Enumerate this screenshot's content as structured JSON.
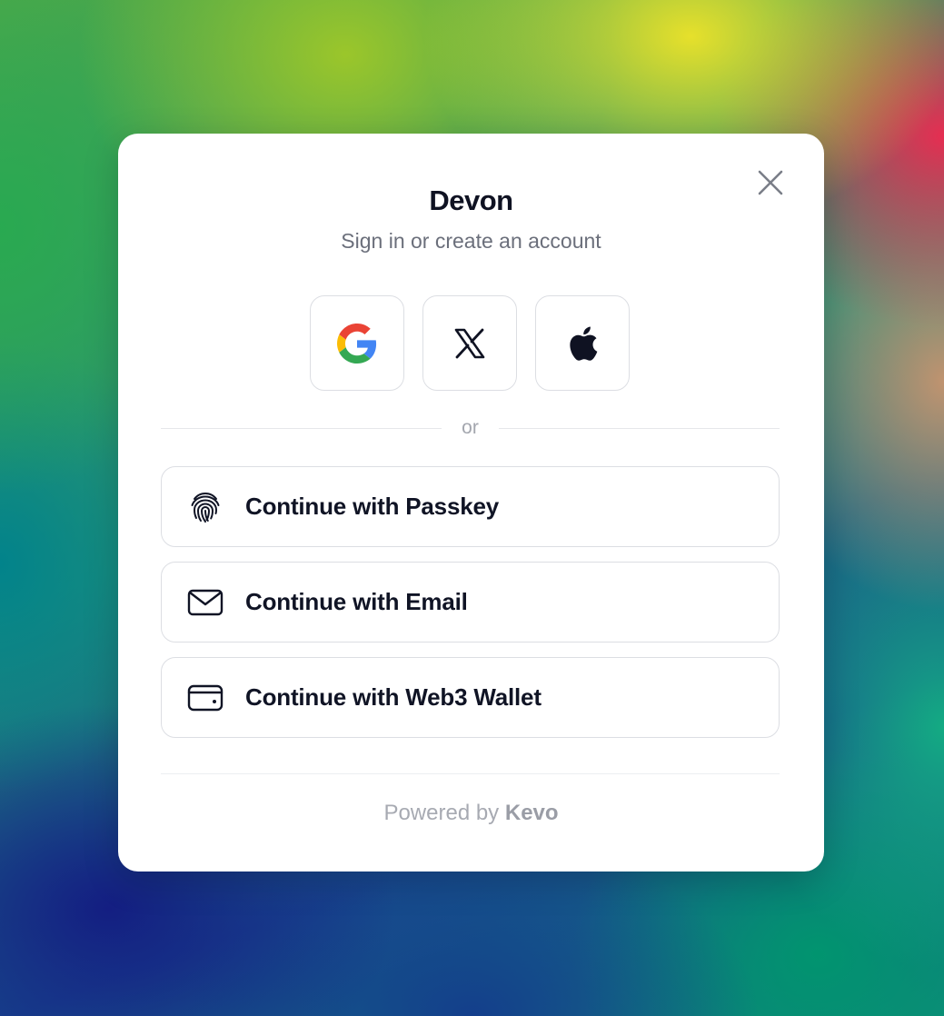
{
  "modal": {
    "title": "Devon",
    "subtitle": "Sign in or create an account",
    "close_icon": "close-icon"
  },
  "social": [
    {
      "name": "Google",
      "icon": "google-icon"
    },
    {
      "name": "X",
      "icon": "x-logo-icon"
    },
    {
      "name": "Apple",
      "icon": "apple-icon"
    }
  ],
  "divider_text": "or",
  "methods": [
    {
      "label": "Continue with Passkey",
      "icon": "fingerprint-icon"
    },
    {
      "label": "Continue with Email",
      "icon": "mail-icon"
    },
    {
      "label": "Continue with Web3 Wallet",
      "icon": "wallet-icon"
    }
  ],
  "footer": {
    "prefix": "Powered by",
    "brand": "Kevo"
  },
  "colors": {
    "title": "#0f1222",
    "subtitle": "#6b6f7b",
    "border": "#dcdee3",
    "footer": "#a7aab2"
  }
}
